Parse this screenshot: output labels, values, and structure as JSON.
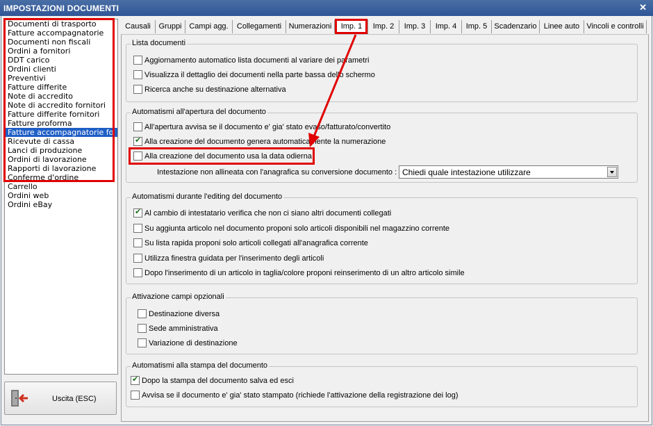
{
  "window": {
    "title": "IMPOSTAZIONI DOCUMENTI",
    "close_icon": "close-icon"
  },
  "doclist": {
    "items": [
      "Documenti di trasporto",
      "Fatture accompagnatorie",
      "Documenti non fiscali",
      "Ordini a fornitori",
      "DDT carico",
      "Ordini clienti",
      "Preventivi",
      "Fatture differite",
      "Note di accredito",
      "Note di accredito fornitori",
      "Fatture differite fornitori",
      "Fatture proforma",
      "Fatture accompagnatorie fo",
      "Ricevute di cassa",
      "Lanci di produzione",
      "Ordini di lavorazione",
      "Rapporti di lavorazione",
      "Conferme d'ordine",
      "Carrello",
      "Ordini web",
      "Ordini eBay"
    ],
    "selected_index": 12
  },
  "exit_button": {
    "label": "Uscita (ESC)",
    "icon": "exit-door-icon"
  },
  "tabs": [
    "Causali",
    "Gruppi",
    "Campi agg.",
    "Collegamenti",
    "Numerazioni",
    "Imp. 1",
    "Imp. 2",
    "Imp. 3",
    "Imp. 4",
    "Imp. 5",
    "Scadenzario",
    "Linee auto",
    "Vincoli e controlli"
  ],
  "active_tab": "Imp. 1",
  "groups": {
    "lista": {
      "title": "Lista documenti",
      "options": [
        {
          "label": "Aggiornamento automatico lista documenti al variare dei parametri",
          "checked": false
        },
        {
          "label": "Visualizza il dettaglio dei documenti nella parte bassa dello schermo",
          "checked": false
        },
        {
          "label": "Ricerca anche su destinazione alternativa",
          "checked": false
        }
      ]
    },
    "apertura": {
      "title": "Automatismi all'apertura del documento",
      "options": [
        {
          "label": "All'apertura avvisa se il documento e' gia' stato evaso/fatturato/convertito",
          "checked": false
        },
        {
          "label": "Alla creazione del documento genera automaticamente la numerazione",
          "checked": true
        },
        {
          "label": "Alla creazione del documento usa la data odierna",
          "checked": false
        }
      ],
      "intestazione_label": "Intestazione non allineata con l'anagrafica su conversione documento :",
      "intestazione_value": "Chiedi quale intestazione utilizzare"
    },
    "editing": {
      "title": "Automatismi durante l'editing del documento",
      "options": [
        {
          "label": "Al cambio di intestatario verifica che non ci siano altri documenti collegati",
          "checked": true
        },
        {
          "label": "Su aggiunta articolo nel documento proponi solo articoli disponibili nel magazzino corrente",
          "checked": false
        },
        {
          "label": "Su lista rapida proponi solo articoli collegati all'anagrafica corrente",
          "checked": false
        },
        {
          "label": "Utilizza finestra guidata per l'inserimento degli articoli",
          "checked": false
        },
        {
          "label": "Dopo l'inserimento di un articolo in taglia/colore proponi reinserimento di un altro articolo simile",
          "checked": false
        }
      ]
    },
    "opzionali": {
      "title": "Attivazione campi opzionali",
      "options": [
        {
          "label": "Destinazione diversa",
          "checked": false
        },
        {
          "label": "Sede amministrativa",
          "checked": false
        },
        {
          "label": "Variazione di destinazione",
          "checked": false
        }
      ]
    },
    "stampa": {
      "title": "Automatismi alla stampa del documento",
      "options": [
        {
          "label": "Dopo la stampa del documento salva ed esci",
          "checked": true
        },
        {
          "label": "Avvisa se il documento e' gia' stato stampato (richiede l'attivazione della registrazione dei log)",
          "checked": false
        }
      ]
    }
  },
  "colors": {
    "titlebar": "#2f5597",
    "selection": "#1f5fc5",
    "annotation": "#e00000"
  }
}
